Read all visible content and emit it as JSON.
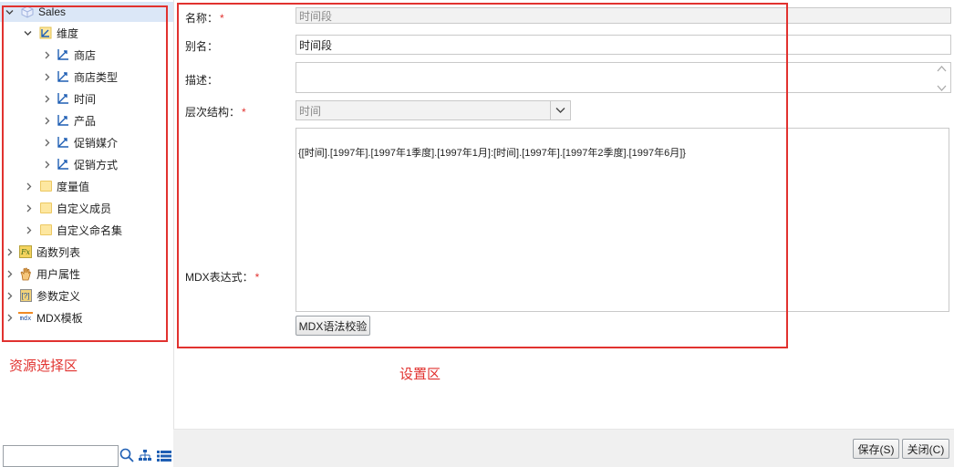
{
  "tree": {
    "root": {
      "label": "Sales",
      "icon": "cube-icon"
    },
    "dimension_group": {
      "label": "维度",
      "icon": "dimension-icon"
    },
    "dimensions": [
      {
        "label": "商店"
      },
      {
        "label": "商店类型"
      },
      {
        "label": "时间"
      },
      {
        "label": "产品"
      },
      {
        "label": "促销媒介"
      },
      {
        "label": "促销方式"
      }
    ],
    "folders": [
      {
        "label": "度量值"
      },
      {
        "label": "自定义成员"
      },
      {
        "label": "自定义命名集"
      }
    ],
    "top_items": [
      {
        "label": "函数列表",
        "icon": "function-icon"
      },
      {
        "label": "用户属性",
        "icon": "hand-icon"
      },
      {
        "label": "参数定义",
        "icon": "parameter-icon"
      },
      {
        "label": "MDX模板",
        "icon": "mdx-template-icon",
        "icon_text": "mdx"
      }
    ],
    "search_placeholder": ""
  },
  "annotations": {
    "left_area": "资源选择区",
    "right_area": "设置区",
    "color": "#e1322f"
  },
  "form": {
    "name": {
      "label": "名称：",
      "required_mark": "*",
      "value": "时间段"
    },
    "alias": {
      "label": "别名：",
      "value": "时间段"
    },
    "description": {
      "label": "描述：",
      "value": ""
    },
    "hierarchy": {
      "label": "层次结构：",
      "required_mark": "*",
      "value": "时间"
    },
    "mdx": {
      "label": "MDX表达式：",
      "required_mark": "*",
      "value": "{[时间].[1997年].[1997年1季度].[1997年1月]:[时间].[1997年].[1997年2季度].[1997年6月]}"
    },
    "mdx_check_button": "MDX语法校验"
  },
  "footer": {
    "save_button": "保存(S)",
    "close_button": "关闭(C)"
  },
  "colors": {
    "selected_row": "#dbe7f7",
    "dimension_icon": "#1f5fb4",
    "disabled_field": "#f2f2f2",
    "bottom_bar": "#f0f0f0"
  }
}
